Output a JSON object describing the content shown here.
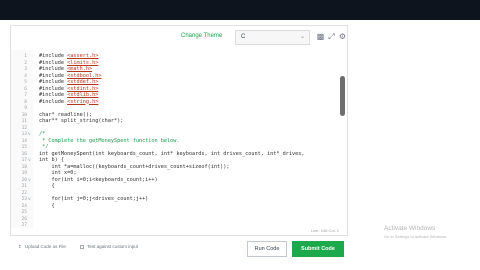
{
  "toolbar": {
    "change_theme": "Change Theme",
    "language": "C",
    "icons": [
      "settings-reset-icon",
      "fullscreen-icon",
      "gear-icon"
    ]
  },
  "code_lines": [
    {
      "n": "1",
      "kind": "include",
      "pre": "#include ",
      "hdr": "<assert.h>"
    },
    {
      "n": "2",
      "kind": "include",
      "pre": "#include ",
      "hdr": "<limits.h>"
    },
    {
      "n": "3",
      "kind": "include",
      "pre": "#include ",
      "hdr": "<math.h>"
    },
    {
      "n": "4",
      "kind": "include",
      "pre": "#include ",
      "hdr": "<stdbool.h>"
    },
    {
      "n": "5",
      "kind": "include",
      "pre": "#include ",
      "hdr": "<stddef.h>"
    },
    {
      "n": "6",
      "kind": "include",
      "pre": "#include ",
      "hdr": "<stdint.h>"
    },
    {
      "n": "7",
      "kind": "include",
      "pre": "#include ",
      "hdr": "<stdlib.h>"
    },
    {
      "n": "8",
      "kind": "include",
      "pre": "#include ",
      "hdr": "<string.h>"
    },
    {
      "n": "9",
      "kind": "code",
      "text": ""
    },
    {
      "n": "10",
      "kind": "code",
      "text": "char* readline();"
    },
    {
      "n": "11",
      "kind": "code",
      "text": "char** split_string(char*);"
    },
    {
      "n": "12",
      "kind": "code",
      "text": ""
    },
    {
      "n": "13",
      "kind": "comment",
      "text": "/*",
      "fold": "v"
    },
    {
      "n": "14",
      "kind": "comment",
      "text": " * Complete the getMoneySpent function below."
    },
    {
      "n": "15",
      "kind": "comment",
      "text": " */"
    },
    {
      "n": "16",
      "kind": "code",
      "text": "int getMoneySpent(int keyboards_count, int* keyboards, int drives_count, int* drives,"
    },
    {
      "n": "17",
      "kind": "code",
      "text": "int b) {",
      "fold": "v"
    },
    {
      "n": "18",
      "kind": "code",
      "text": "    int *a=malloc((keyboards_count+drives_count+sizeof(int));"
    },
    {
      "n": "19",
      "kind": "code",
      "text": "    int x=0;"
    },
    {
      "n": "20",
      "kind": "code",
      "text": "    for(int i=0;i<keyboards_count;i++)",
      "fold": "v"
    },
    {
      "n": "21",
      "kind": "code",
      "text": "    {"
    },
    {
      "n": "22",
      "kind": "code",
      "text": ""
    },
    {
      "n": "23",
      "kind": "code",
      "text": "    for(int j=0;j<drives_count;j++)",
      "fold": "v"
    },
    {
      "n": "24",
      "kind": "code",
      "text": "    {"
    },
    {
      "n": "25",
      "kind": "code",
      "text": ""
    },
    {
      "n": "26",
      "kind": "code",
      "text": ""
    },
    {
      "n": "27",
      "kind": "code",
      "text": ""
    }
  ],
  "statusline": "Line: 146 Col: 1",
  "footer": {
    "upload_label": "Upload Code as File",
    "test_label": "Test against custom input",
    "run_label": "Run Code",
    "submit_label": "Submit Code"
  },
  "watermark": {
    "title": "Activate Windows",
    "subtitle": "Go to Settings to activate Windows."
  },
  "colors": {
    "accent": "#1ba94c",
    "topbar": "#0e141e"
  }
}
